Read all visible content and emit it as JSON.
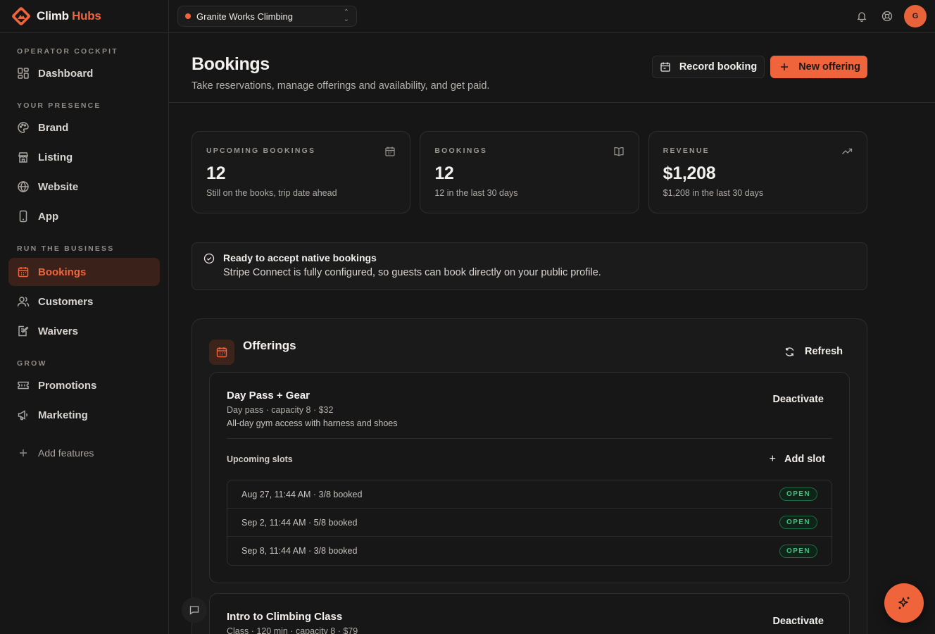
{
  "brand": {
    "name_part1": "Climb",
    "name_part2": "Hubs",
    "logo_icon": "mountain-diamond-icon",
    "accent": "#f0643c"
  },
  "workspace": {
    "name": "Granite Works Climbing",
    "status_color": "#f0643c"
  },
  "topbar": {
    "icons": [
      "bell-icon",
      "help-icon"
    ],
    "avatar_letter": "G"
  },
  "sidebar": {
    "sections": [
      {
        "label": "OPERATOR COCKPIT",
        "items": [
          {
            "label": "Dashboard",
            "icon": "dashboard-icon"
          }
        ]
      },
      {
        "label": "YOUR PRESENCE",
        "items": [
          {
            "label": "Brand",
            "icon": "palette-icon"
          },
          {
            "label": "Listing",
            "icon": "store-icon"
          },
          {
            "label": "Website",
            "icon": "globe-icon"
          },
          {
            "label": "App",
            "icon": "phone-icon"
          }
        ]
      },
      {
        "label": "RUN THE BUSINESS",
        "items": [
          {
            "label": "Bookings",
            "icon": "calendar-icon",
            "active": true
          },
          {
            "label": "Customers",
            "icon": "users-icon"
          },
          {
            "label": "Waivers",
            "icon": "waiver-icon"
          }
        ]
      },
      {
        "label": "GROW",
        "items": [
          {
            "label": "Promotions",
            "icon": "ticket-icon"
          },
          {
            "label": "Marketing",
            "icon": "megaphone-icon"
          }
        ]
      }
    ],
    "add_features": "Add features"
  },
  "header": {
    "title": "Bookings",
    "subtitle": "Take reservations, manage offerings and availability, and get paid.",
    "record_booking": "Record booking",
    "new_offering": "New offering"
  },
  "stats": [
    {
      "label": "UPCOMING BOOKINGS",
      "value": "12",
      "note": "Still on the books, trip date ahead",
      "icon": "calendar-icon"
    },
    {
      "label": "BOOKINGS",
      "value": "12",
      "note": "12 in the last 30 days",
      "icon": "book-icon"
    },
    {
      "label": "REVENUE",
      "value": "$1,208",
      "note": "$1,208 in the last 30 days",
      "icon": "trending-up-icon"
    }
  ],
  "notice": {
    "title": "Ready to accept native bookings",
    "body": "Stripe Connect is fully configured, so guests can book directly on your public profile."
  },
  "offerings": {
    "title": "Offerings",
    "refresh": "Refresh",
    "items": [
      {
        "name": "Day Pass + Gear",
        "meta": "Day pass · capacity 8 · $32",
        "description": "All-day gym access with harness and shoes",
        "deactivate": "Deactivate",
        "slots_label": "Upcoming slots",
        "add_slot": "Add slot",
        "slots": [
          {
            "text": "Aug 27, 11:44 AM · 3/8 booked",
            "status": "OPEN"
          },
          {
            "text": "Sep 2, 11:44 AM · 5/8 booked",
            "status": "OPEN"
          },
          {
            "text": "Sep 8, 11:44 AM · 3/8 booked",
            "status": "OPEN"
          }
        ]
      },
      {
        "name": "Intro to Climbing Class",
        "meta": "Class · 120 min · capacity 8 · $79",
        "deactivate": "Deactivate"
      }
    ]
  }
}
